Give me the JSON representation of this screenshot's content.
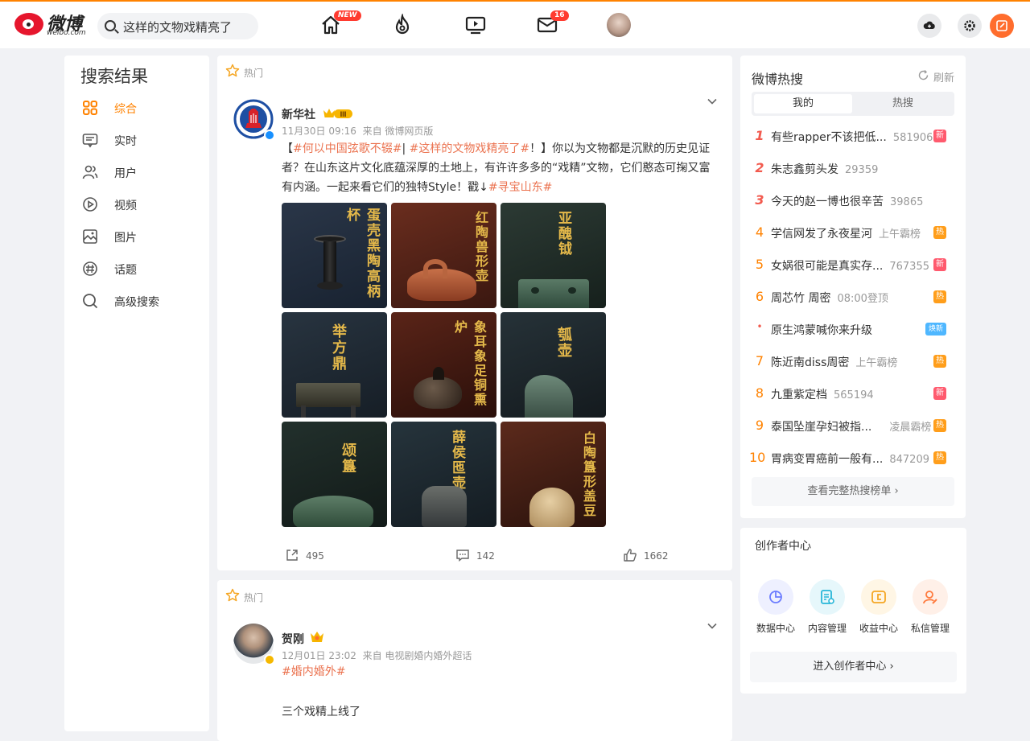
{
  "header": {
    "logo_text": "微博",
    "logo_sub": "weibo.com",
    "search_value": "这样的文物戏精亮了",
    "home_badge": "NEW",
    "message_badge": "16"
  },
  "leftnav": {
    "title": "搜索结果",
    "items": [
      {
        "label": "综合",
        "icon": "grid-icon"
      },
      {
        "label": "实时",
        "icon": "realtime-icon"
      },
      {
        "label": "用户",
        "icon": "user-icon"
      },
      {
        "label": "视频",
        "icon": "video-icon"
      },
      {
        "label": "图片",
        "icon": "image-icon"
      },
      {
        "label": "话题",
        "icon": "topic-icon"
      },
      {
        "label": "高级搜索",
        "icon": "search-icon"
      }
    ]
  },
  "posts": [
    {
      "hot_label": "热门",
      "author": "新华社",
      "vip_level": "Ⅲ",
      "time": "11月30日 09:16",
      "source": "来自 微博网页版",
      "text_parts": [
        "【",
        "#何以中国弦歌不辍#",
        "| ",
        "#这样的文物戏精亮了#",
        "！】你以为文物都是沉默的历史见证者？在山东这片文化底蕴深厚的土地上，有许许多多的“戏精”文物，它们憨态可掬又富有内涵。一起来看它们的独特Style！戳↓",
        "#寻宝山东#"
      ],
      "images": [
        {
          "title": "蛋壳黑陶高柄杯"
        },
        {
          "title": "红陶兽形壶"
        },
        {
          "title": "亚醜钺"
        },
        {
          "title": "举方鼎"
        },
        {
          "title": "象耳象足铜熏炉"
        },
        {
          "title": "瓠壶"
        },
        {
          "title": "颂簋"
        },
        {
          "title": "薛侯匜壶"
        },
        {
          "title": "白陶簋形盖豆"
        }
      ],
      "reposts": "495",
      "comments": "142",
      "likes": "1662"
    },
    {
      "hot_label": "热门",
      "author": "贺刚",
      "time": "12月01日 23:02",
      "source": "来自 电视剧婚内婚外超话",
      "tag": "#婚内婚外#",
      "text": "三个戏精上线了"
    }
  ],
  "hotsearch": {
    "title": "微博热搜",
    "refresh": "刷新",
    "tabs": [
      "我的",
      "热搜"
    ],
    "items": [
      {
        "rank": "1",
        "text": "有些rapper不该把低...",
        "num": "581906",
        "label": "新",
        "type": "xin"
      },
      {
        "rank": "2",
        "text": "朱志鑫剪头发",
        "num": "29359",
        "label": "",
        "type": ""
      },
      {
        "rank": "3",
        "text": "今天的赵一博也很辛苦",
        "num": "39865",
        "label": "",
        "type": ""
      },
      {
        "rank": "4",
        "text": "学信网发了永夜星河",
        "num": "上午霸榜",
        "label": "热",
        "type": "re"
      },
      {
        "rank": "5",
        "text": "女娲很可能是真实存...",
        "num": "767355",
        "label": "新",
        "type": "xin"
      },
      {
        "rank": "6",
        "text": "周芯竹 周密",
        "num": "08:00登顶",
        "label": "热",
        "type": "re"
      },
      {
        "rank": "•",
        "text": "原生鸿蒙喊你来升级",
        "num": "",
        "label": "焕新",
        "type": "huan"
      },
      {
        "rank": "7",
        "text": "陈近南diss周密",
        "num": "上午霸榜",
        "label": "热",
        "type": "re"
      },
      {
        "rank": "8",
        "text": "九重紫定档",
        "num": "565194",
        "label": "新",
        "type": "xin"
      },
      {
        "rank": "9",
        "text": "泰国坠崖孕妇被指...",
        "num": "凌晨霸榜",
        "label": "热",
        "type": "re"
      },
      {
        "rank": "10",
        "text": "胃病变胃癌前一般有...",
        "num": "847209",
        "label": "热",
        "type": "re"
      }
    ],
    "more": "查看完整热搜榜单 ›"
  },
  "creator": {
    "title": "创作者中心",
    "items": [
      {
        "label": "数据中心",
        "icon": "data-icon",
        "color": "#6b7cff"
      },
      {
        "label": "内容管理",
        "icon": "content-icon",
        "color": "#27b6d8"
      },
      {
        "label": "收益中心",
        "icon": "income-icon",
        "color": "#f5a623"
      },
      {
        "label": "私信管理",
        "icon": "message-manage-icon",
        "color": "#ff7a3d"
      }
    ],
    "enter": "进入创作者中心 ›"
  }
}
